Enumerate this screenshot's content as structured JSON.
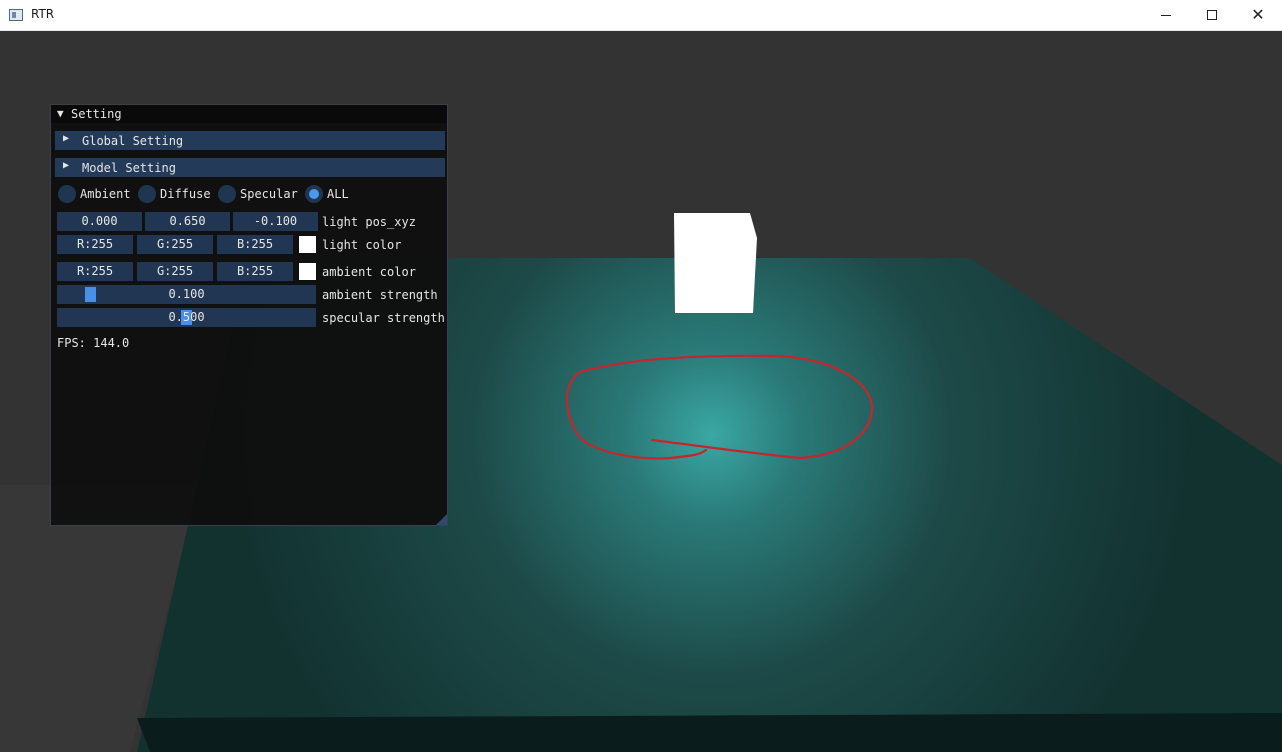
{
  "window": {
    "title": "RTR"
  },
  "panel": {
    "title": "Setting",
    "headers": [
      {
        "label": "Global Setting"
      },
      {
        "label": "Model Setting"
      }
    ],
    "shading_modes": [
      {
        "label": "Ambient",
        "selected": false
      },
      {
        "label": "Diffuse",
        "selected": false
      },
      {
        "label": "Specular",
        "selected": false
      },
      {
        "label": "ALL",
        "selected": true
      }
    ],
    "light_pos": {
      "x": "0.000",
      "y": "0.650",
      "z": "-0.100",
      "label": "light pos_xyz"
    },
    "light_color": {
      "r": "R:255",
      "g": "G:255",
      "b": "B:255",
      "label": "light color",
      "swatch": "#ffffff"
    },
    "ambient_color": {
      "r": "R:255",
      "g": "G:255",
      "b": "B:255",
      "label": "ambient color",
      "swatch": "#ffffff"
    },
    "ambient_strength": {
      "value": "0.100",
      "fraction": 0.1,
      "label": "ambient strength"
    },
    "specular_strength": {
      "value": "0.500",
      "fraction": 0.5,
      "label": "specular strength"
    },
    "fps": "FPS: 144.0"
  },
  "scene": {
    "background": "#333333",
    "floor_color": "#1d4a48",
    "highlight_color": "#3aa8a4",
    "cube_color": "#ffffff",
    "annotation_color": "#c8242c"
  }
}
